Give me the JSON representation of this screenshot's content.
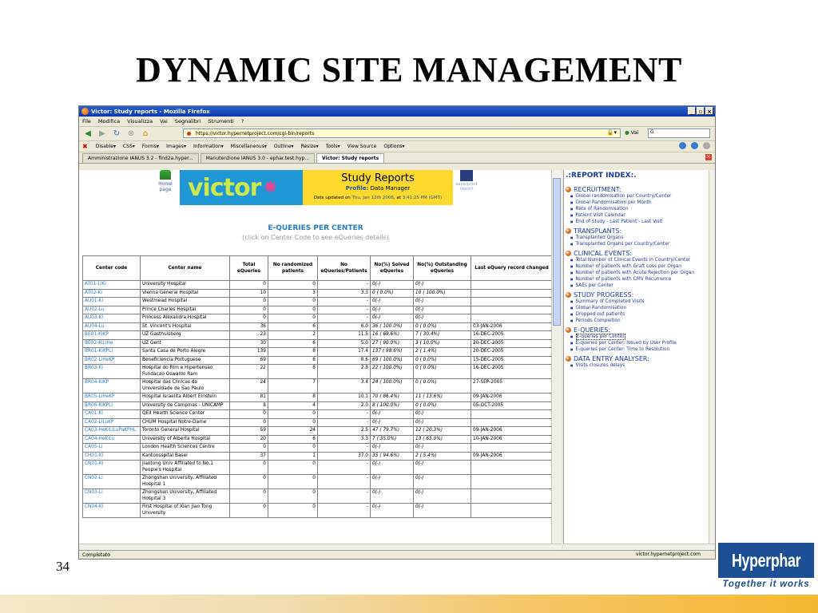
{
  "slide": {
    "title": "DYNAMIC SITE MANAGEMENT",
    "page_number": "34",
    "logo_text": "Hyperphar",
    "logo_tagline": "Together it works"
  },
  "browser": {
    "window_title": "Victor: Study reports - Mozilla Firefox",
    "menu": [
      "File",
      "Modifica",
      "Visualizza",
      "Vai",
      "Segnalibri",
      "Strumenti",
      "?"
    ],
    "url": "https://victor.hypernetproject.com/cgi-bin/reports",
    "go_label": "Vai",
    "dev_toolbar": [
      "Disable▾",
      "CSS▾",
      "Forms▾",
      "Images▾",
      "Information▾",
      "Miscellaneous▾",
      "Outline▾",
      "Resize▾",
      "Tools▾",
      "View Source",
      "Options▾"
    ],
    "tabs": [
      {
        "label": "Amministrazione IANUS 3.2 - find2a.hyper..."
      },
      {
        "label": "Manutenzione IANUS 3.0 - ephar.test.hyp..."
      },
      {
        "label": "Victor: Study reports"
      }
    ],
    "status_left": "Completato",
    "status_right": "victor.hypernetproject.com"
  },
  "report": {
    "home_label": "Home page",
    "brand": "victor",
    "heading": "Study Reports",
    "profile_label": "Profile:",
    "profile_value": "Data Manager",
    "updated_prefix": "Dats updated on",
    "updated_date": "Thu, Jan 12th 2006",
    "updated_at": ", at",
    "updated_time": "3:41:25 PM (GMT)",
    "save_print": "save/print report",
    "section_title": "E-QUERIES PER CENTER",
    "section_sub": "(click on Center Code to see eQueries details)",
    "columns": [
      "Center code",
      "Center name",
      "Total eQueries",
      "No randomized patients",
      "No eQueries/Patients",
      "No(%) Solved eQueries",
      "No(%) Outstanding eQueries",
      "Last eQuery record changed"
    ],
    "rows": [
      {
        "code": "AT01-LiKi",
        "name": "University Hospital",
        "total": "0",
        "rand": "0",
        "ratio": "-",
        "solved": "0(-)",
        "outstanding": "0(-)",
        "last": ""
      },
      {
        "code": "AT02-Ki",
        "name": "Vienna General Hospital",
        "total": "10",
        "rand": "3",
        "ratio": "3.3",
        "solved": "0 ( 0.0%)",
        "outstanding": "10 ( 100.0%)",
        "last": ""
      },
      {
        "code": "AU01-Ki",
        "name": "Westmead Hospital",
        "total": "0",
        "rand": "0",
        "ratio": "-",
        "solved": "0(-)",
        "outstanding": "0(-)",
        "last": ""
      },
      {
        "code": "AU02-Lu",
        "name": "Prince Charles Hospital",
        "total": "0",
        "rand": "0",
        "ratio": "-",
        "solved": "0(-)",
        "outstanding": "0(-)",
        "last": ""
      },
      {
        "code": "AU03-Ki",
        "name": "Princess Alexandra Hospital",
        "total": "0",
        "rand": "0",
        "ratio": "-",
        "solved": "0(-)",
        "outstanding": "0(-)",
        "last": ""
      },
      {
        "code": "AU04-Lu",
        "name": "St. Vincent's Hospital",
        "total": "36",
        "rand": "6",
        "ratio": "6.0",
        "solved": "36 ( 100.0%)",
        "outstanding": "0 ( 0.0%)",
        "last": "03-JAN-2006"
      },
      {
        "code": "BE01-KiKP",
        "name": "UZ Gasthuisberg",
        "total": "23",
        "rand": "2",
        "ratio": "11.5",
        "solved": "16 ( 69.6%)",
        "outstanding": "7 ( 30.4%)",
        "last": "16-DEC-2005"
      },
      {
        "code": "BE02-KiLiHe",
        "name": "UZ Gent",
        "total": "30",
        "rand": "6",
        "ratio": "5.0",
        "solved": "27 ( 90.0%)",
        "outstanding": "3 ( 10.0%)",
        "last": "20-DEC-2005"
      },
      {
        "code": "BR01-KiKPLi",
        "name": "Santa Casa de Porto Alegre",
        "total": "139",
        "rand": "8",
        "ratio": "17.4",
        "solved": "137 ( 98.6%)",
        "outstanding": "2 ( 1.4%)",
        "last": "20-DEC-2005"
      },
      {
        "code": "BR02-LiHeKP",
        "name": "Beneficiencia Portuguese",
        "total": "69",
        "rand": "8",
        "ratio": "8.6",
        "solved": "69 ( 100.0%)",
        "outstanding": "0 ( 0.0%)",
        "last": "15-DEC-2005"
      },
      {
        "code": "BR03-Ki",
        "name": "Hospital do Rim e Hipertensao Fundacao Oswaldo Ram",
        "total": "22",
        "rand": "8",
        "ratio": "2.8",
        "solved": "22 ( 100.0%)",
        "outstanding": "0 ( 0.0%)",
        "last": "16-DEC-2005",
        "tall": true
      },
      {
        "code": "BR04-KiKP",
        "name": "Hospital das Clinicas da Universidade de Sao Paulo",
        "total": "24",
        "rand": "7",
        "ratio": "3.4",
        "solved": "24 ( 100.0%)",
        "outstanding": "0 ( 0.0%)",
        "last": "27-SEP-2005",
        "tall": true
      },
      {
        "code": "BR05-LiHeKP",
        "name": "Hospital Israelita Albert Einstein",
        "total": "81",
        "rand": "8",
        "ratio": "10.1",
        "solved": "70 ( 86.4%)",
        "outstanding": "11 ( 13.6%)",
        "last": "09-JAN-2006"
      },
      {
        "code": "BR06-KiKPLi",
        "name": "University de Campinas - UNICAMP",
        "total": "8",
        "rand": "4",
        "ratio": "2.0",
        "solved": "8 ( 100.0%)",
        "outstanding": "0 ( 0.0%)",
        "last": "05-OCT-2005"
      },
      {
        "code": "CA01-Ki",
        "name": "QEII Health Science Center",
        "total": "0",
        "rand": "0",
        "ratio": "-",
        "solved": "0(-)",
        "outstanding": "0(-)",
        "last": ""
      },
      {
        "code": "CA02-LiLuKP",
        "name": "CHUM Hospital Notre-Dame",
        "total": "0",
        "rand": "0",
        "ratio": "-",
        "solved": "0(-)",
        "outstanding": "0(-)",
        "last": ""
      },
      {
        "code": "CA03-HeKiLiLuPaKPHL",
        "name": "Toronto General Hospital",
        "total": "59",
        "rand": "24",
        "ratio": "2.5",
        "solved": "47 ( 79.7%)",
        "outstanding": "12 ( 20.3%)",
        "last": "09-JAN-2006"
      },
      {
        "code": "CA04-HeKiLu",
        "name": "University of Alberta Hospital",
        "total": "20",
        "rand": "6",
        "ratio": "3.3",
        "solved": "7 ( 35.0%)",
        "outstanding": "13 ( 65.0%)",
        "last": "10-JAN-2006"
      },
      {
        "code": "CA05-Li",
        "name": "London Health Sciences Centre",
        "total": "0",
        "rand": "0",
        "ratio": "-",
        "solved": "0(-)",
        "outstanding": "0(-)",
        "last": ""
      },
      {
        "code": "CH01-Ki",
        "name": "Kantonsspital Basel",
        "total": "37",
        "rand": "1",
        "ratio": "37.0",
        "solved": "35 ( 94.6%)",
        "outstanding": "2 ( 5.4%)",
        "last": "09-JAN-2006"
      },
      {
        "code": "CN01-Ki",
        "name": "Jiaotong Univ Affiliated to No.1 People's Hospital",
        "total": "0",
        "rand": "0",
        "ratio": "-",
        "solved": "0(-)",
        "outstanding": "0(-)",
        "last": "",
        "tall": true
      },
      {
        "code": "CN02-Li",
        "name": "Zhongshan University, Affiliated Hospital 1",
        "total": "0",
        "rand": "0",
        "ratio": "-",
        "solved": "0(-)",
        "outstanding": "0(-)",
        "last": "",
        "tall": true
      },
      {
        "code": "CN03-Li",
        "name": "Zhongshan University, Affiliated Hospital 3",
        "total": "0",
        "rand": "0",
        "ratio": "-",
        "solved": "0(-)",
        "outstanding": "0(-)",
        "last": "",
        "tall": true
      },
      {
        "code": "CN04-Ki",
        "name": "First Hospital of Xian Jiao Tong University",
        "total": "0",
        "rand": "0",
        "ratio": "-",
        "solved": "0(-)",
        "outstanding": "0(-)",
        "last": "",
        "tall": true
      }
    ]
  },
  "index": {
    "title": ".:REPORT INDEX:.",
    "sections": [
      {
        "heading": "RECRUITMENT:",
        "items": [
          "Global randomisation per Country/Center",
          "Global Randomisation per Month",
          "Rate of Randomisation",
          "Patient Visit Calendar",
          "End of Study - Last Patient - Last Visit"
        ]
      },
      {
        "heading": "TRANSPLANTS:",
        "items": [
          "Transplanted Organs",
          "Transplanted Organs per Country/Center"
        ]
      },
      {
        "heading": "CLINICAL EVENTS:",
        "items": [
          "Total Number of Clinical Events in Country/Center",
          "Number of patients with Graft Loss per Organ",
          "Number of patients with Acute Rejection per Organ",
          "Number of patients with CMV Recurrence",
          "SAEs per Center"
        ]
      },
      {
        "heading": "STUDY PROGRESS:",
        "items": [
          "Summary of Completed Visits",
          "Global Randomisation",
          "Dropped out patients",
          "Periods Completion"
        ]
      },
      {
        "heading": "E-QUERIES:",
        "items": [
          "E-queries per Center",
          "E-queries per Center: Issued by User Profile",
          "E-queries per Center: Time to Resolution"
        ]
      },
      {
        "heading": "DATA ENTRY ANALYSER:",
        "items": [
          "Visits closures delays"
        ]
      }
    ]
  }
}
